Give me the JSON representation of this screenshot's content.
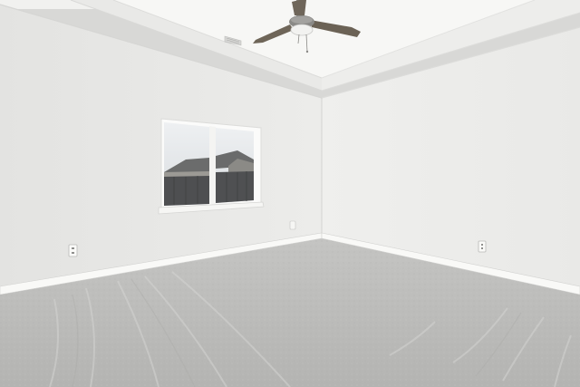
{
  "scene": {
    "subject": "empty-carpeted-room",
    "colors": {
      "left_wall": "#e6e6e4",
      "right_wall": "#eeeeec",
      "ceiling": "#f3f3f1",
      "tray_ceiling": "#f7f7f5",
      "carpet": "#bdbdbb",
      "baseboard": "#f8f8f6",
      "window_trim": "#fbfbfa",
      "sky": "#e3e6e8",
      "fence": "#4e4f51",
      "roof": "#6a6b6b",
      "fan_blade": "#6e6558",
      "fan_metal": "#8a8986"
    },
    "icons": [
      "ceiling-fan-icon",
      "air-vent-icon",
      "electrical-outlet-icon"
    ]
  }
}
